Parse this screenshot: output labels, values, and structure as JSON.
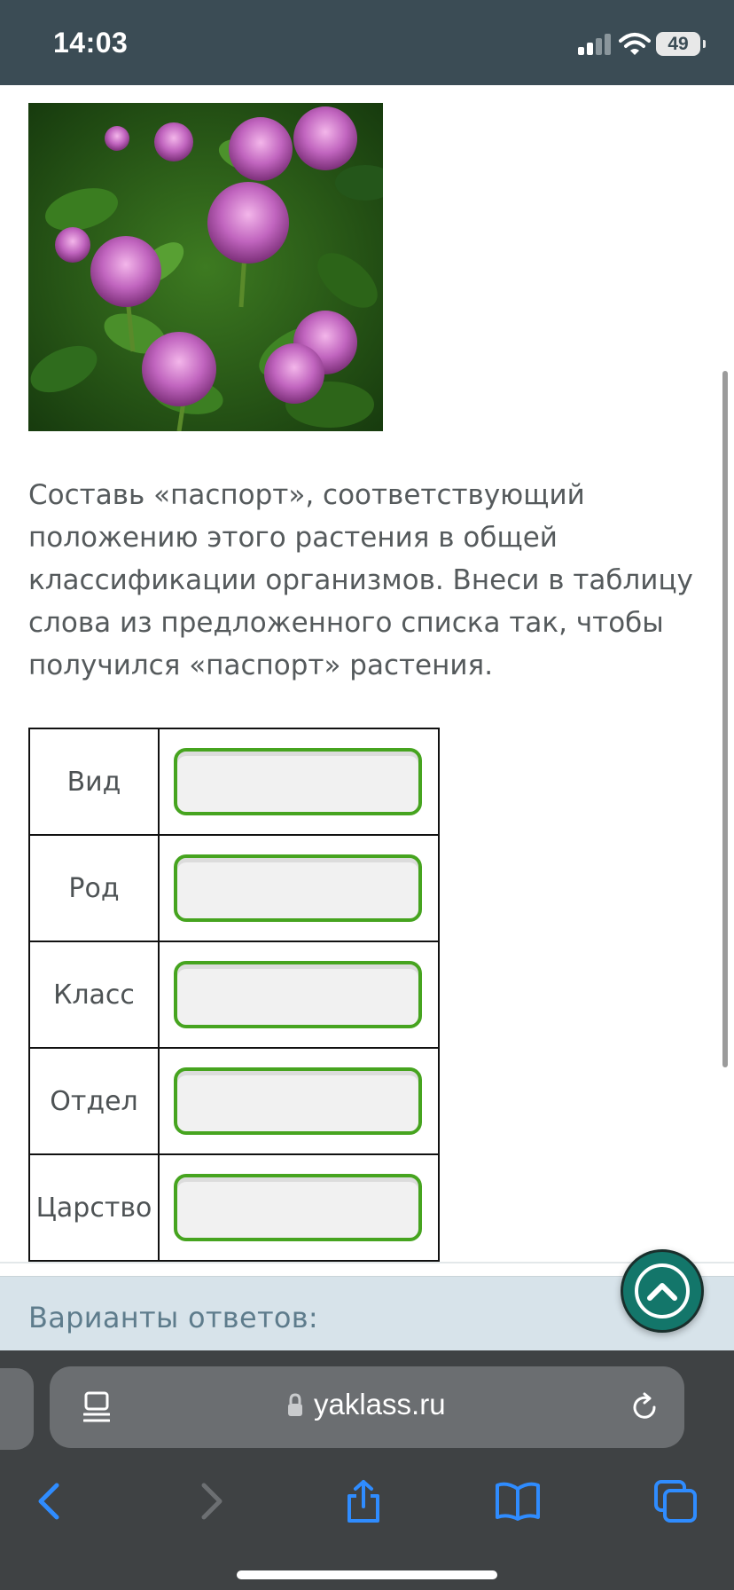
{
  "status_bar": {
    "time": "14:03",
    "battery": "49",
    "icons": [
      "signal-icon",
      "wifi-icon",
      "battery-icon"
    ]
  },
  "content": {
    "image_icon": "clover-photo",
    "task_text": "Составь «паспорт», соответствующий положению этого растения в общей классификации организмов. Внеси в таблицу слова из предложенного списка так, чтобы получился «паспорт» растения.",
    "table": {
      "rows": [
        {
          "label": "Вид",
          "value": ""
        },
        {
          "label": "Род",
          "value": ""
        },
        {
          "label": "Класс",
          "value": ""
        },
        {
          "label": "Отдел",
          "value": ""
        },
        {
          "label": "Царство",
          "value": ""
        }
      ]
    },
    "colors": {
      "drop_border": "#46a41f",
      "drop_fill": "#f1f1f1",
      "status_bar": "#3b4c55",
      "scroll_top_button": "#13766a",
      "answers_panel": "#d7e3ea"
    }
  },
  "answers_panel": {
    "title": "Варианты ответов:",
    "scroll_top_icon": "chevron-up-icon"
  },
  "browser": {
    "url": "yaklass.ru",
    "icons": [
      "reader-icon",
      "lock-icon",
      "reload-icon",
      "back-icon",
      "forward-icon",
      "share-icon",
      "bookmarks-icon",
      "tabs-icon"
    ],
    "accent": "#2f8cff"
  }
}
